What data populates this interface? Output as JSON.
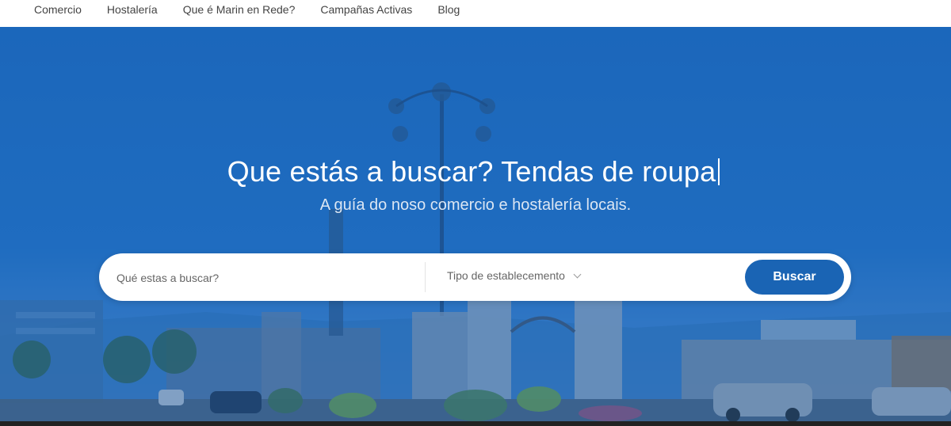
{
  "nav": {
    "items": [
      {
        "label": "Comercio"
      },
      {
        "label": "Hostalería"
      },
      {
        "label": "Que é Marin en Rede?"
      },
      {
        "label": "Campañas Activas"
      },
      {
        "label": "Blog"
      }
    ]
  },
  "hero": {
    "headline": "Que estás a buscar? Tendas de roupa",
    "subline": "A guía do noso comercio e hostalería locais.",
    "overlay_color": "#1f6cc0"
  },
  "search": {
    "placeholder": "Qué estas a buscar?",
    "type_select_label": "Tipo de establecemento",
    "button_label": "Buscar",
    "button_color": "#1a64b4"
  }
}
